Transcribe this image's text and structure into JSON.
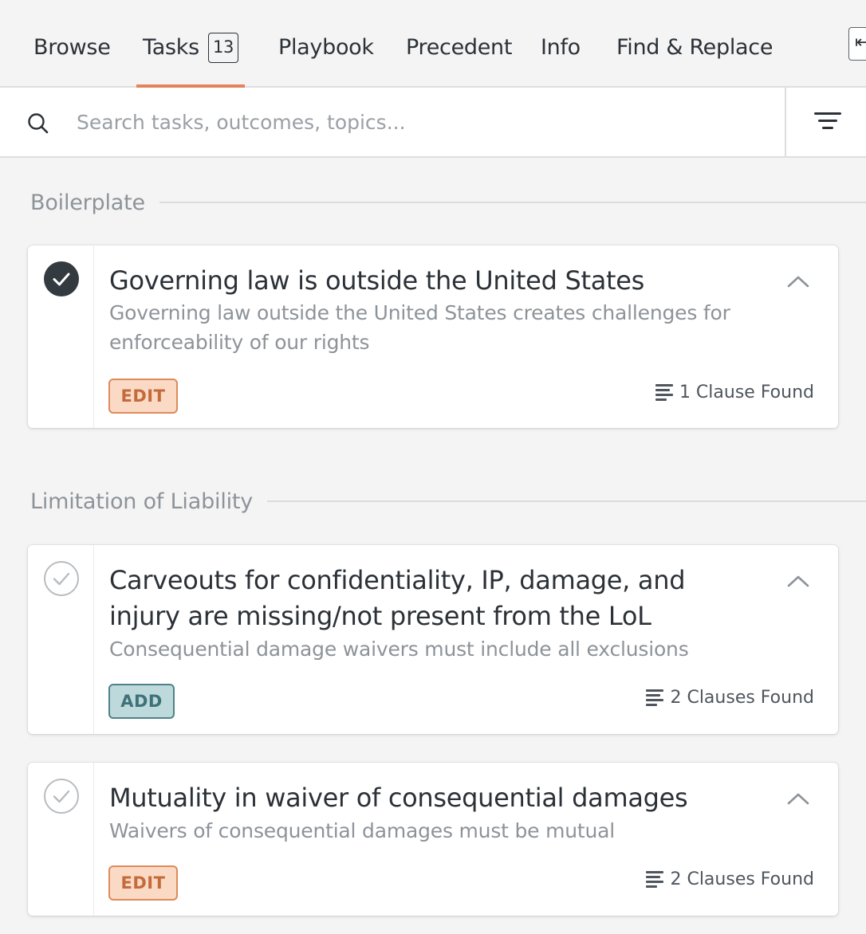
{
  "tabs": {
    "browse": "Browse",
    "tasks": "Tasks",
    "tasks_count": "13",
    "playbook": "Playbook",
    "precedent": "Precedent",
    "info": "Info",
    "find_replace": "Find & Replace",
    "active": "tasks"
  },
  "collapse_icon": "arrow-left-icon",
  "search": {
    "placeholder": "Search tasks, outcomes, topics...",
    "value": "",
    "icon": "search-icon",
    "filter_icon": "filter-lines-icon"
  },
  "colors": {
    "accent": "#e4825a",
    "edit_tag_bg": "#fadac4",
    "edit_tag_text": "#c46a3b",
    "add_tag_bg": "#bdd9dc",
    "add_tag_text": "#3e7278",
    "check_done": "#333a40"
  },
  "sections": [
    {
      "label": "Boilerplate",
      "tasks": [
        {
          "done": true,
          "title": "Governing law is outside the United States",
          "description": "Governing law outside the United States creates challenges for enforceability of our rights",
          "action": "EDIT",
          "clauses": "1 Clause Found"
        }
      ]
    },
    {
      "label": "Limitation of Liability",
      "tasks": [
        {
          "done": false,
          "title": "Carveouts for confidentiality, IP, damage, and injury are missing/not present from the LoL",
          "description": "Consequential damage waivers must include all exclusions",
          "action": "ADD",
          "clauses": "2 Clauses Found"
        },
        {
          "done": false,
          "title": "Mutuality in waiver of consequential damages",
          "description": "Waivers of consequential damages must be mutual",
          "action": "EDIT",
          "clauses": "2 Clauses Found"
        }
      ]
    }
  ]
}
